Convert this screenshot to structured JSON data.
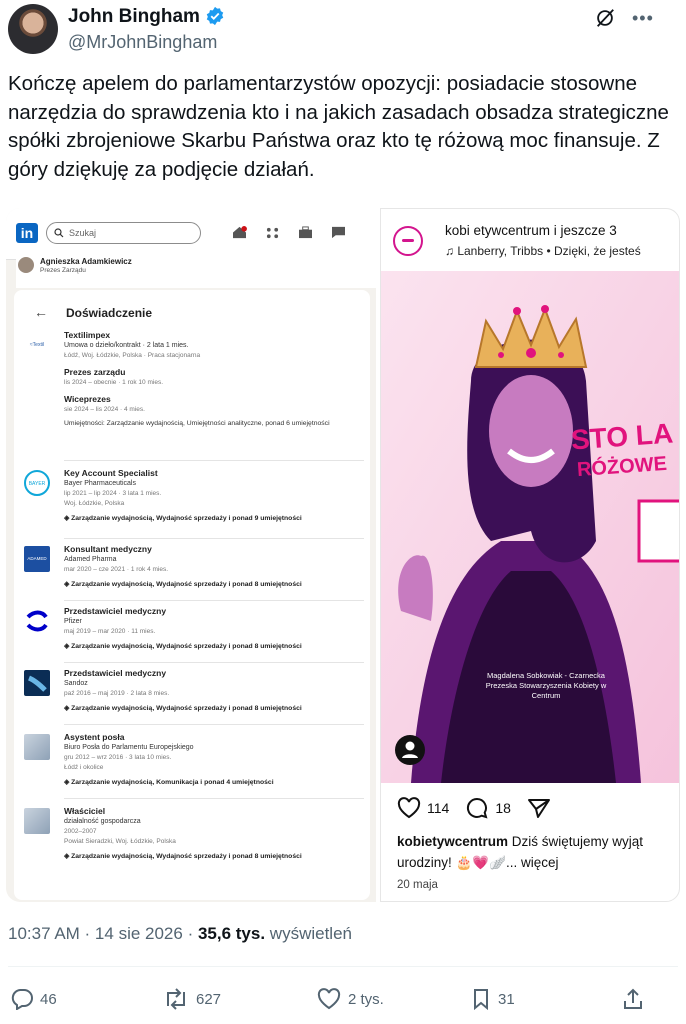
{
  "tweet": {
    "author_name": "John Bingham",
    "author_handle": "@MrJohnBingham",
    "text": "Kończę apelem do parlamentarzystów opozycji: posiadacie stosowne narzędzia do sprawdzenia kto i na jakich zasadach obsadza strategiczne spółki zbrojeniowe Skarbu Państwa oraz kto tę różową moc finansuje. Z góry dziękuję za podjęcie działań.",
    "time": "10:37 AM · 14 sie 2026 · ",
    "views_count": "35,6 tys.",
    "views_label": " wyświetleń",
    "replies": "46",
    "reposts": "627",
    "likes": "2 tys.",
    "bookmarks": "31",
    "verified_color": "#1d9bf0"
  },
  "linkedin": {
    "logo": "in",
    "search_placeholder": "Szukaj",
    "profile_name": "Agnieszka Adamkiewicz",
    "profile_title": "Prezes Zarządu",
    "section_title": "Doświadczenie",
    "experience": [
      {
        "company": "Textilimpex",
        "contract": "Umowa o dzieło/kontrakt · 2 lata 1 mies.",
        "location": "Łódź, Woj. Łódzkie, Polska · Praca stacjonarna",
        "roles": [
          {
            "title": "Prezes zarządu",
            "dates": "lis 2024 – obecnie · 1 rok 10 mies."
          },
          {
            "title": "Wiceprezes",
            "dates": "sie 2024 – lis 2024 · 4 mies."
          }
        ],
        "skills": "Umiejętności: Zarządzanie wydajnością, Umiejętności analityczne, ponad 6 umiejętności"
      },
      {
        "title": "Key Account Specialist",
        "company": "Bayer Pharmaceuticals",
        "dates": "lip 2021 – lip 2024 · 3 lata 1 mies.",
        "location": "Woj. Łódzkie, Polska",
        "skills": "Zarządzanie wydajnością, Wydajność sprzedaży i ponad 9 umiejętności"
      },
      {
        "title": "Konsultant medyczny",
        "company": "Adamed Pharma",
        "dates": "mar 2020 – cze 2021 · 1 rok 4 mies.",
        "skills": "Zarządzanie wydajnością, Wydajność sprzedaży i ponad 8 umiejętności"
      },
      {
        "title": "Przedstawiciel medyczny",
        "company": "Pfizer",
        "dates": "maj 2019 – mar 2020 · 11 mies.",
        "skills": "Zarządzanie wydajnością, Wydajność sprzedaży i ponad 8 umiejętności"
      },
      {
        "title": "Przedstawiciel medyczny",
        "company": "Sandoz",
        "dates": "paź 2016 – maj 2019 · 2 lata 8 mies.",
        "skills": "Zarządzanie wydajnością, Wydajność sprzedaży i ponad 8 umiejętności"
      },
      {
        "title": "Asystent posła",
        "company": "Biuro Posła do Parlamentu Europejskiego",
        "dates": "gru 2012 – wrz 2016 · 3 lata 10 mies.",
        "location": "Łódź i okolice",
        "skills": "Zarządzanie wydajnością, Komunikacja i ponad 4 umiejętności"
      },
      {
        "title": "Właściciel",
        "company": "działalność gospodarcza",
        "dates": "2002–2007",
        "location": "Powiat Sieradzki, Woj. Łódzkie, Polska",
        "skills": "Zarządzanie wydajnością, Wydajność sprzedaży i ponad 8 umiejętności"
      }
    ]
  },
  "instagram": {
    "title": "kobi etywcentrum i jeszcze 3",
    "music": "♫ Lanberry, Tribbs  •  Dzięki, że jesteś",
    "photo_heading_1": "STO LA",
    "photo_heading_2": "RÓŻOWE",
    "photo_caption": "Magdalena Sobkowiak - Czarnecka Prezeska Stowarzyszenia Kobiety w Centrum",
    "likes": "114",
    "comments": "18",
    "caption_user": "kobietywcentrum",
    "caption_text": " Dziś świętujemy wyjąt urodziny! 🎂💗🪽... więcej",
    "date": "20 maja",
    "accent_color": "#e1137d"
  }
}
